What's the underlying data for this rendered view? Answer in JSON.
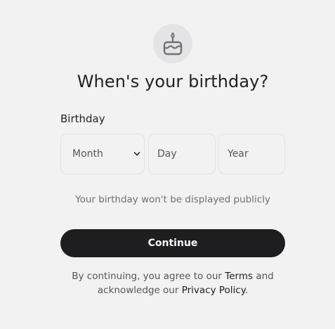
{
  "header": {
    "icon": "birthday-cake-icon",
    "title": "When's your birthday?"
  },
  "form": {
    "label": "Birthday",
    "month_placeholder": "Month",
    "day_placeholder": "Day",
    "year_placeholder": "Year",
    "privacy_note": "Your birthday won't be displayed publicly",
    "continue_label": "Continue"
  },
  "legal": {
    "part1": "By continuing, you agree to our ",
    "terms_link": "Terms",
    "part2": " and acknowledge our ",
    "privacy_link": "Privacy Policy",
    "part3": "."
  },
  "colors": {
    "background": "#f2f2f2",
    "button": "#1e1e20",
    "icon_circle": "#e4e4e6"
  }
}
